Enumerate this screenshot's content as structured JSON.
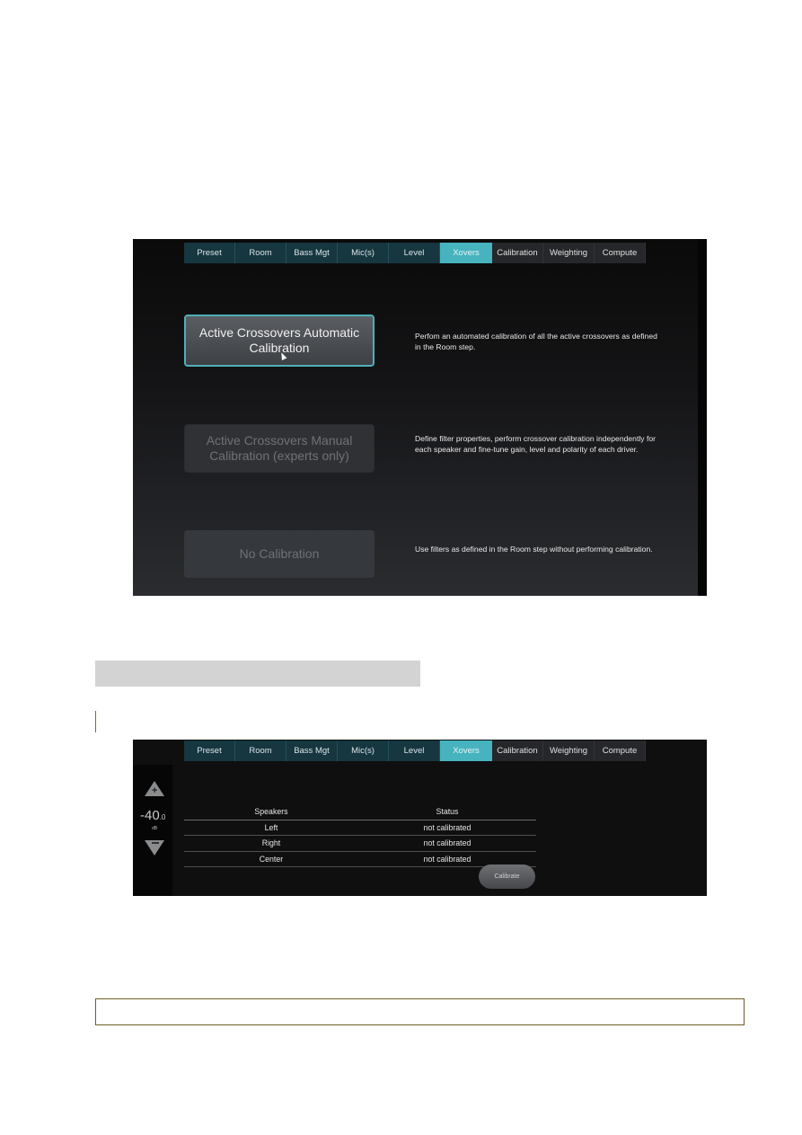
{
  "screen1": {
    "tabs": [
      "Preset",
      "Room",
      "Bass Mgt",
      "Mic(s)",
      "Level",
      "Xovers",
      "Calibration",
      "Weighting",
      "Compute"
    ],
    "active_tab": "Xovers",
    "options": [
      {
        "label": "Active Crossovers Automatic Calibration",
        "description": "Perfom an automated calibration of all the active crossovers as defined in the Room step.",
        "state": "selected"
      },
      {
        "label": "Active Crossovers Manual Calibration (experts only)",
        "description": "Define filter properties, perform crossover calibration independently for each speaker and fine-tune gain, level and polarity of each driver.",
        "state": "disabled"
      },
      {
        "label": "No Calibration",
        "description": "Use filters as defined in the Room step without performing calibration.",
        "state": "disabled"
      }
    ]
  },
  "screen2": {
    "tabs": [
      "Preset",
      "Room",
      "Bass Mgt",
      "Mic(s)",
      "Level",
      "Xovers",
      "Calibration",
      "Weighting",
      "Compute"
    ],
    "active_tab": "Xovers",
    "volume": {
      "value": "-40",
      "decimal": ".0",
      "unit": "dB"
    },
    "table": {
      "headers": [
        "Speakers",
        "Status"
      ],
      "rows": [
        [
          "Left",
          "not calibrated"
        ],
        [
          "Right",
          "not calibrated"
        ],
        [
          "Center",
          "not calibrated"
        ]
      ]
    },
    "calibrate_label": "Calibrate"
  }
}
